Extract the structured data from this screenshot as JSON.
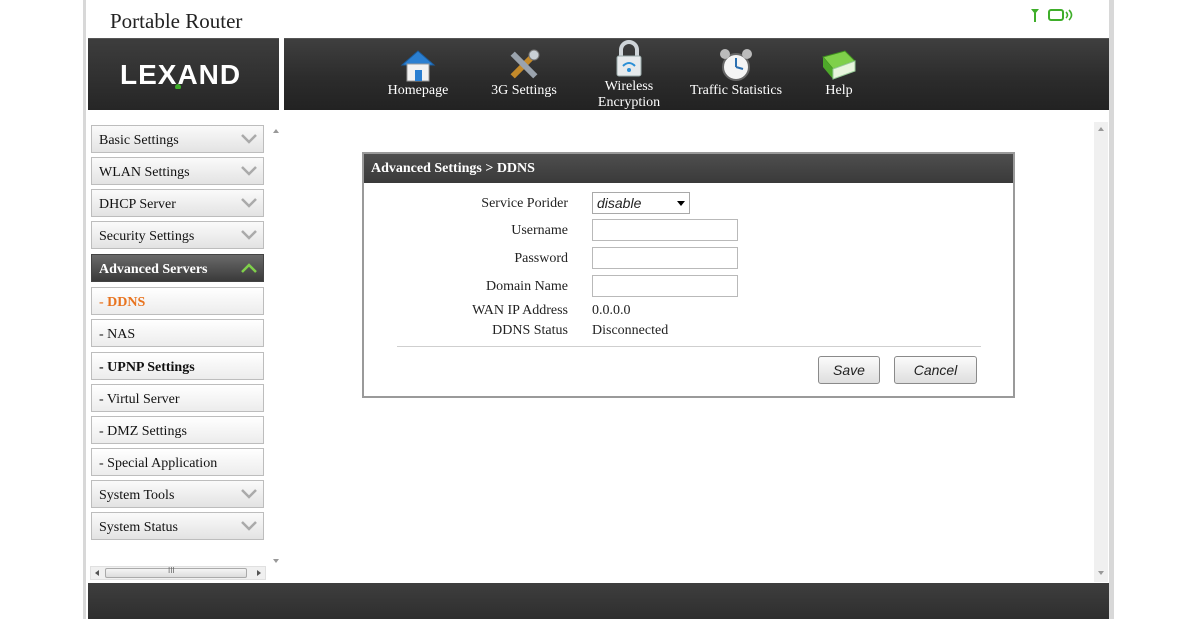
{
  "header": {
    "title": "Portable Router",
    "logo_text": "LEXAND",
    "status_icons": [
      "signal-antenna-icon",
      "wifi-device-icon"
    ]
  },
  "nav": [
    {
      "label": "Homepage",
      "icon": "home-icon"
    },
    {
      "label": "3G Settings",
      "icon": "tools-icon"
    },
    {
      "label": "Wireless\nEncryption",
      "icon": "lock-icon"
    },
    {
      "label": "Traffic Statistics",
      "icon": "alarm-clock-icon"
    },
    {
      "label": "Help",
      "icon": "help-book-icon"
    }
  ],
  "sidebar": {
    "items": [
      {
        "label": "Basic Settings"
      },
      {
        "label": "WLAN Settings"
      },
      {
        "label": "DHCP Server"
      },
      {
        "label": "Security Settings"
      },
      {
        "label": "Advanced Servers"
      },
      {
        "label": "- DDNS"
      },
      {
        "label": "- NAS"
      },
      {
        "label": "- UPNP Settings"
      },
      {
        "label": "- Virtul Server"
      },
      {
        "label": "- DMZ Settings"
      },
      {
        "label": "- Special Application"
      },
      {
        "label": "System Tools"
      },
      {
        "label": "System Status"
      }
    ],
    "hscroll_label": "III"
  },
  "panel": {
    "title": "Advanced Settings > DDNS",
    "service_provider_label": "Service Porider",
    "service_provider_value": "disable",
    "username_label": "Username",
    "username_value": "",
    "password_label": "Password",
    "password_value": "",
    "domain_label": "Domain Name",
    "domain_value": "",
    "wan_ip_label": "WAN IP Address",
    "wan_ip_value": "0.0.0.0",
    "ddns_status_label": "DDNS Status",
    "ddns_status_value": "Disconnected",
    "save_label": "Save",
    "cancel_label": "Cancel"
  },
  "colors": {
    "accent_orange": "#e8731e",
    "bar_dark": "#2c2c2c",
    "signal_green": "#3fae2a"
  }
}
